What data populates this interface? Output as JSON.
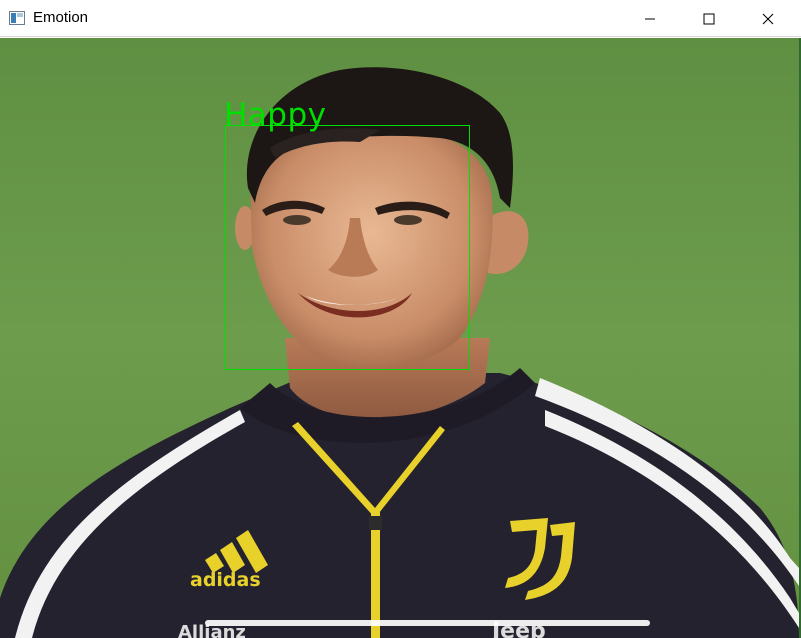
{
  "window": {
    "title": "Emotion",
    "controls": [
      "minimize-icon",
      "maximize-icon",
      "close-icon"
    ]
  },
  "detection": {
    "label": "Happy",
    "box_color": "#00e000"
  },
  "image": {
    "background_color": "#6a9a4c",
    "jersey_logo_text": "adidas",
    "sponsor_text": "Allianz",
    "sponsor_text_2": "Jeep"
  },
  "colors": {
    "accent": "#00e000",
    "titlebar": "#ffffff"
  }
}
